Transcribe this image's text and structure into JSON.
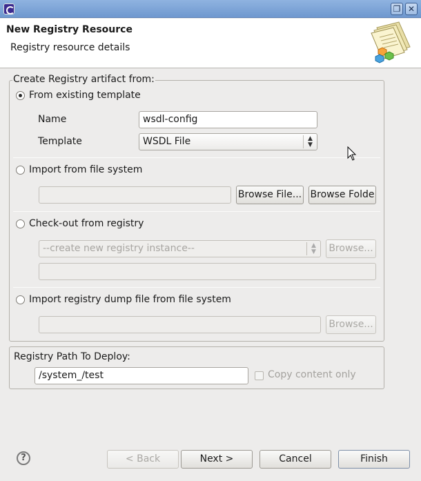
{
  "window": {
    "restore_glyph": "❐",
    "close_glyph": "✕"
  },
  "header": {
    "title": "New Registry Resource",
    "subtitle": "Registry resource details"
  },
  "create_group": {
    "title": "Create Registry artifact from:",
    "from_template": {
      "label": "From existing template",
      "selected": true,
      "name_label": "Name",
      "name_value": "wsdl-config",
      "template_label": "Template",
      "template_value": "WSDL File"
    },
    "import_fs": {
      "label": "Import from file system",
      "selected": false,
      "path_value": "",
      "browse_file": "Browse File...",
      "browse_folder": "Browse Folde"
    },
    "checkout": {
      "label": "Check-out from registry",
      "selected": false,
      "instance_value": "--create new registry instance--",
      "browse": "Browse...",
      "path_value": ""
    },
    "dump": {
      "label": "Import registry dump file from file system",
      "selected": false,
      "path_value": "",
      "browse": "Browse..."
    }
  },
  "deploy_group": {
    "title": "Registry Path To Deploy:",
    "path_value": "/system_/test",
    "copy_content_label": "Copy content only",
    "copy_content_checked": false
  },
  "footer": {
    "help_glyph": "?",
    "back": "< Back",
    "next": "Next >",
    "cancel": "Cancel",
    "finish": "Finish"
  },
  "icons": [
    "app-icon",
    "restore-icon",
    "close-icon",
    "registry-wizard-icon",
    "help-icon",
    "mouse-cursor-icon"
  ]
}
